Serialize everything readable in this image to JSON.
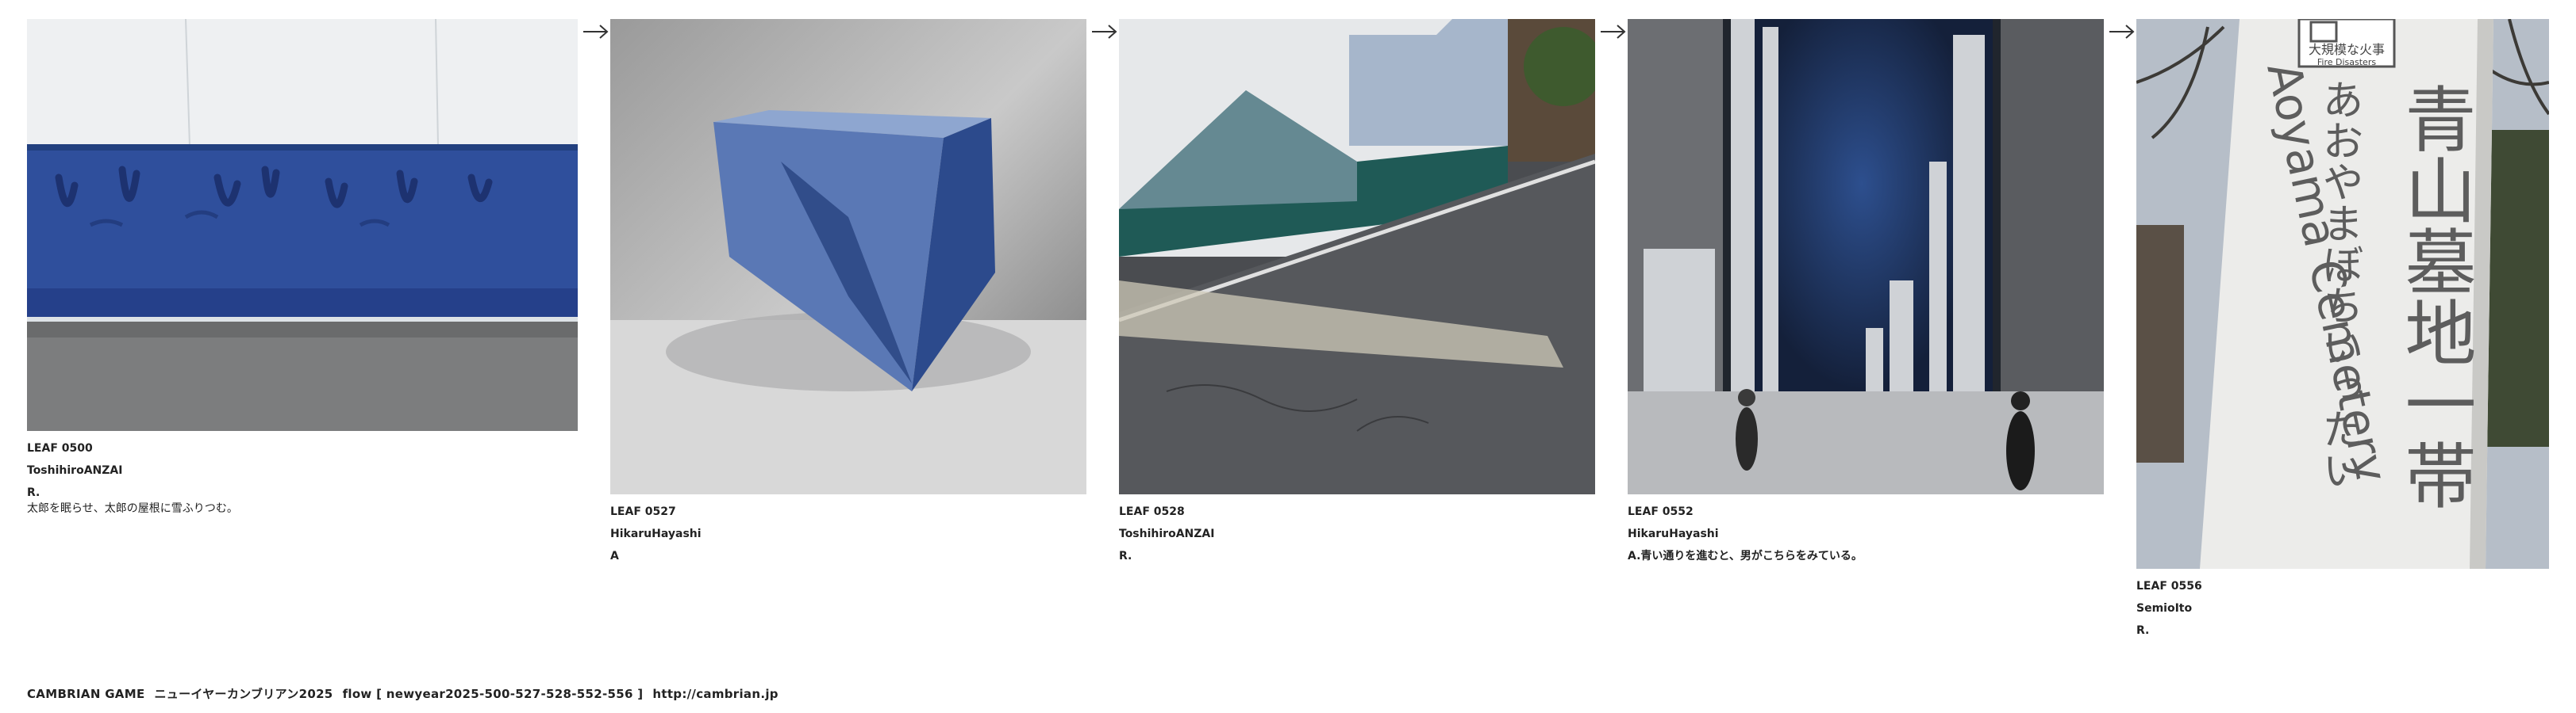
{
  "leaves": [
    {
      "id": "LEAF 0500",
      "author": "ToshihiroANZAI",
      "response": "R.",
      "note": "太郎を眠らせ、太郎の屋根に雪ふりつむ。",
      "image": "blue-painted-wall-photo"
    },
    {
      "id": "LEAF 0527",
      "author": "HikaruHayashi",
      "response": "A",
      "note": "",
      "image": "blue-glass-cube-photo"
    },
    {
      "id": "LEAF 0528",
      "author": "ToshihiroANZAI",
      "response": "R.",
      "note": "",
      "image": "street-shadow-photo"
    },
    {
      "id": "LEAF 0552",
      "author": "HikaruHayashi",
      "response": "A.青い通りを進むと、男がこちらをみている。",
      "note": "",
      "image": "surreal-city-photo"
    },
    {
      "id": "LEAF 0556",
      "author": "SemioIto",
      "response": "R.",
      "note": "",
      "image": "cemetery-sign-photo"
    }
  ],
  "sign": {
    "badge": "大規模な火事",
    "badge_en": "Fire Disasters",
    "line1": "青山墓地一帯",
    "line2": "あおやまぼちいったい",
    "line3": "Aoyama Cemetery"
  },
  "footer": {
    "title": "CAMBRIAN GAME",
    "subtitle": "ニューイヤーカンブリアン2025",
    "flow": "flow [ newyear2025-500-527-528-552-556 ]",
    "url": "http://cambrian.jp"
  },
  "icons": {
    "flow_arrow": "arrow-right-icon"
  }
}
